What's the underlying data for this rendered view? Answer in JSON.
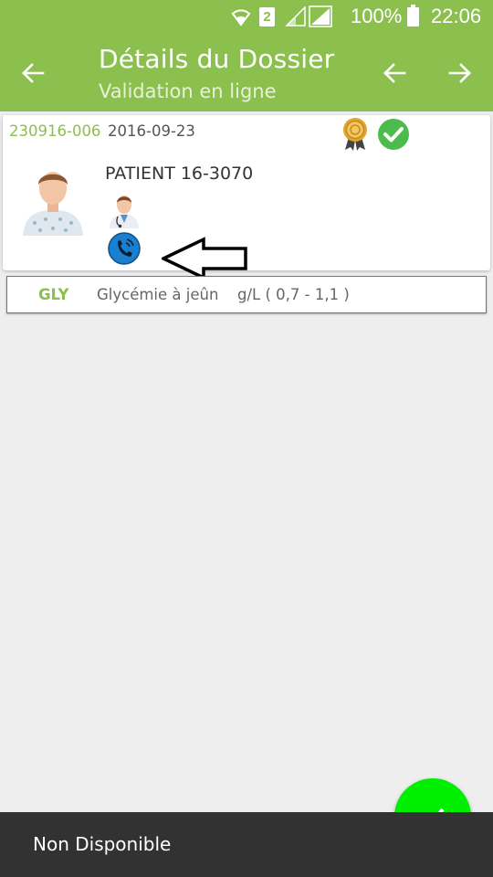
{
  "status_bar": {
    "sim_slot": "2",
    "battery": "100%",
    "time": "22:06",
    "icons": [
      "wifi-icon",
      "sim-icon",
      "signal-icon",
      "signal-icon",
      "battery-icon"
    ]
  },
  "toolbar": {
    "title": "Détails du Dossier",
    "subtitle": "Validation en ligne",
    "icons": [
      "back-arrow-icon",
      "previous-arrow-icon",
      "next-arrow-icon"
    ]
  },
  "dossier": {
    "number": "230916-006",
    "date": "2016-09-23",
    "patient_name": "PATIENT 16-3070",
    "icons": [
      "award-badge-icon",
      "validated-check-icon",
      "patient-avatar-icon",
      "doctor-icon",
      "phone-icon",
      "annotation-arrow-icon"
    ]
  },
  "tests": [
    {
      "code": "GLY",
      "name": "Glycémie à jeûn",
      "unit_range": "g/L ( 0,7 - 1,1 )"
    }
  ],
  "snackbar": {
    "message": "Non Disponible"
  },
  "colors": {
    "primary": "#8cc04e",
    "fab": "#00ee00",
    "snackbar": "#323232",
    "check": "#4cbb4c",
    "phone": "#1a7fcf"
  }
}
